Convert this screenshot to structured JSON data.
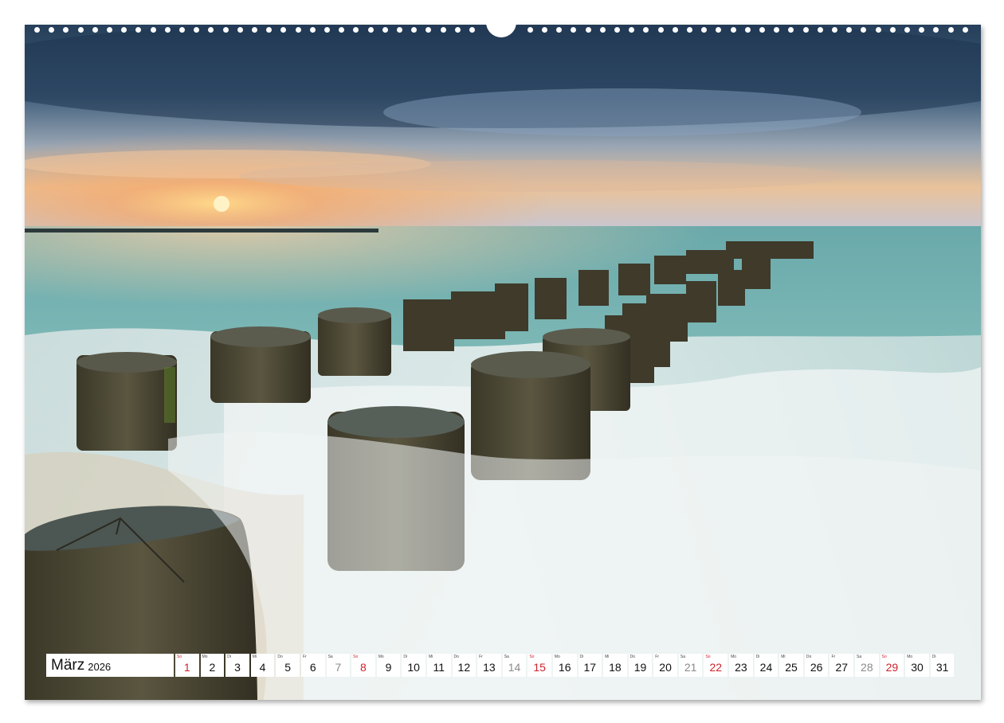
{
  "calendar": {
    "month": "März",
    "year": "2026",
    "days": [
      {
        "wd": "So",
        "num": "1",
        "type": "sun"
      },
      {
        "wd": "Mo",
        "num": "2",
        "type": "weekday"
      },
      {
        "wd": "Di",
        "num": "3",
        "type": "weekday"
      },
      {
        "wd": "Mi",
        "num": "4",
        "type": "weekday"
      },
      {
        "wd": "Do",
        "num": "5",
        "type": "weekday"
      },
      {
        "wd": "Fr",
        "num": "6",
        "type": "weekday"
      },
      {
        "wd": "Sa",
        "num": "7",
        "type": "sat"
      },
      {
        "wd": "So",
        "num": "8",
        "type": "sun"
      },
      {
        "wd": "Mo",
        "num": "9",
        "type": "weekday"
      },
      {
        "wd": "Di",
        "num": "10",
        "type": "weekday"
      },
      {
        "wd": "Mi",
        "num": "11",
        "type": "weekday"
      },
      {
        "wd": "Do",
        "num": "12",
        "type": "weekday"
      },
      {
        "wd": "Fr",
        "num": "13",
        "type": "weekday"
      },
      {
        "wd": "Sa",
        "num": "14",
        "type": "sat"
      },
      {
        "wd": "So",
        "num": "15",
        "type": "sun"
      },
      {
        "wd": "Mo",
        "num": "16",
        "type": "weekday"
      },
      {
        "wd": "Di",
        "num": "17",
        "type": "weekday"
      },
      {
        "wd": "Mi",
        "num": "18",
        "type": "weekday"
      },
      {
        "wd": "Do",
        "num": "19",
        "type": "weekday"
      },
      {
        "wd": "Fr",
        "num": "20",
        "type": "weekday"
      },
      {
        "wd": "Sa",
        "num": "21",
        "type": "sat"
      },
      {
        "wd": "So",
        "num": "22",
        "type": "sun"
      },
      {
        "wd": "Mo",
        "num": "23",
        "type": "weekday"
      },
      {
        "wd": "Di",
        "num": "24",
        "type": "weekday"
      },
      {
        "wd": "Mi",
        "num": "25",
        "type": "weekday"
      },
      {
        "wd": "Do",
        "num": "26",
        "type": "weekday"
      },
      {
        "wd": "Fr",
        "num": "27",
        "type": "weekday"
      },
      {
        "wd": "Sa",
        "num": "28",
        "type": "sat"
      },
      {
        "wd": "So",
        "num": "29",
        "type": "sun"
      },
      {
        "wd": "Mo",
        "num": "30",
        "type": "weekday"
      },
      {
        "wd": "Di",
        "num": "31",
        "type": "weekday"
      }
    ]
  },
  "colors": {
    "sunday": "#d1202a",
    "saturday": "#8a8a8a",
    "sky_top": "#2d4a66",
    "sunset": "#f3b27a",
    "sea": "#5fa7a6",
    "foam": "#e8eeee",
    "post": "#4a4634"
  }
}
